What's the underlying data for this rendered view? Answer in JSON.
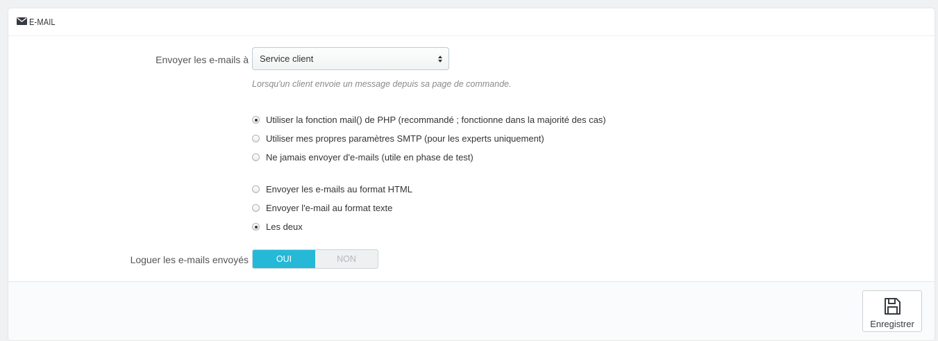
{
  "panel": {
    "heading_icon": "envelope-icon",
    "heading": "E-MAIL"
  },
  "send_to": {
    "label": "Envoyer les e-mails à",
    "selected": "Service client",
    "hint": "Lorsqu'un client envoie un message depuis sa page de commande."
  },
  "mail_method": {
    "options": [
      {
        "label": "Utiliser la fonction mail() de PHP (recommandé ; fonctionne dans la majorité des cas)",
        "checked": true
      },
      {
        "label": "Utiliser mes propres paramètres SMTP (pour les experts uniquement)",
        "checked": false
      },
      {
        "label": "Ne jamais envoyer d'e-mails (utile en phase de test)",
        "checked": false
      }
    ]
  },
  "mail_format": {
    "options": [
      {
        "label": "Envoyer les e-mails au format HTML",
        "checked": false
      },
      {
        "label": "Envoyer l'e-mail au format texte",
        "checked": false
      },
      {
        "label": "Les deux",
        "checked": true
      }
    ]
  },
  "log_emails": {
    "label": "Loguer les e-mails envoyés",
    "yes": "OUI",
    "no": "NON",
    "value": "OUI"
  },
  "footer": {
    "save_label": "Enregistrer",
    "save_icon": "floppy-disk-icon"
  },
  "colors": {
    "accent": "#25b9d7"
  }
}
